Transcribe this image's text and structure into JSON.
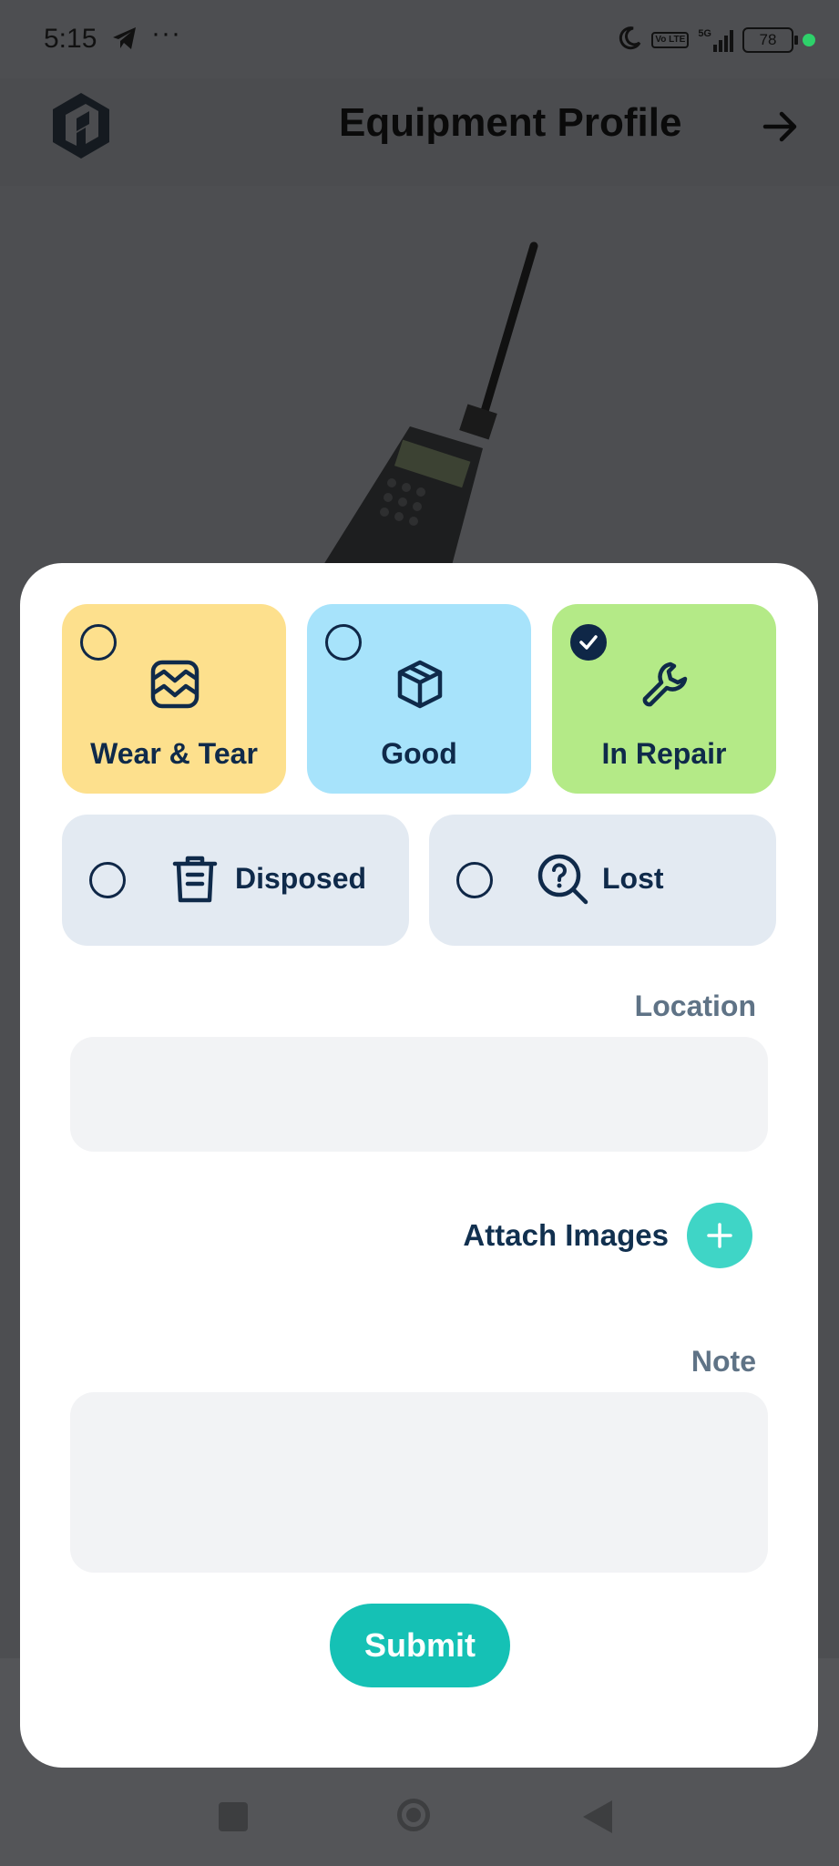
{
  "status_bar": {
    "time": "5:15",
    "battery": "78",
    "volte": "Vo LTE",
    "network": "5G"
  },
  "header": {
    "title": "Equipment Profile"
  },
  "statuses": [
    {
      "label": "Wear & Tear",
      "icon": "wear-tear-icon",
      "checked": false,
      "color": "#fde08d"
    },
    {
      "label": "Good",
      "icon": "box-icon",
      "checked": false,
      "color": "#a7e3fb"
    },
    {
      "label": "In Repair",
      "icon": "wrench-icon",
      "checked": true,
      "color": "#b4ea87"
    },
    {
      "label": "Disposed",
      "icon": "trash-icon",
      "checked": false,
      "color": "#e3eaf2"
    },
    {
      "label": "Lost",
      "icon": "question-search-icon",
      "checked": false,
      "color": "#e3eaf2"
    }
  ],
  "form": {
    "location_label": "Location",
    "location_value": "",
    "attach_label": "Attach Images",
    "note_label": "Note",
    "note_value": "",
    "submit_label": "Submit"
  },
  "colors": {
    "accent": "#15c1b5",
    "attach": "#3fd5c6",
    "navy": "#0f2747"
  }
}
